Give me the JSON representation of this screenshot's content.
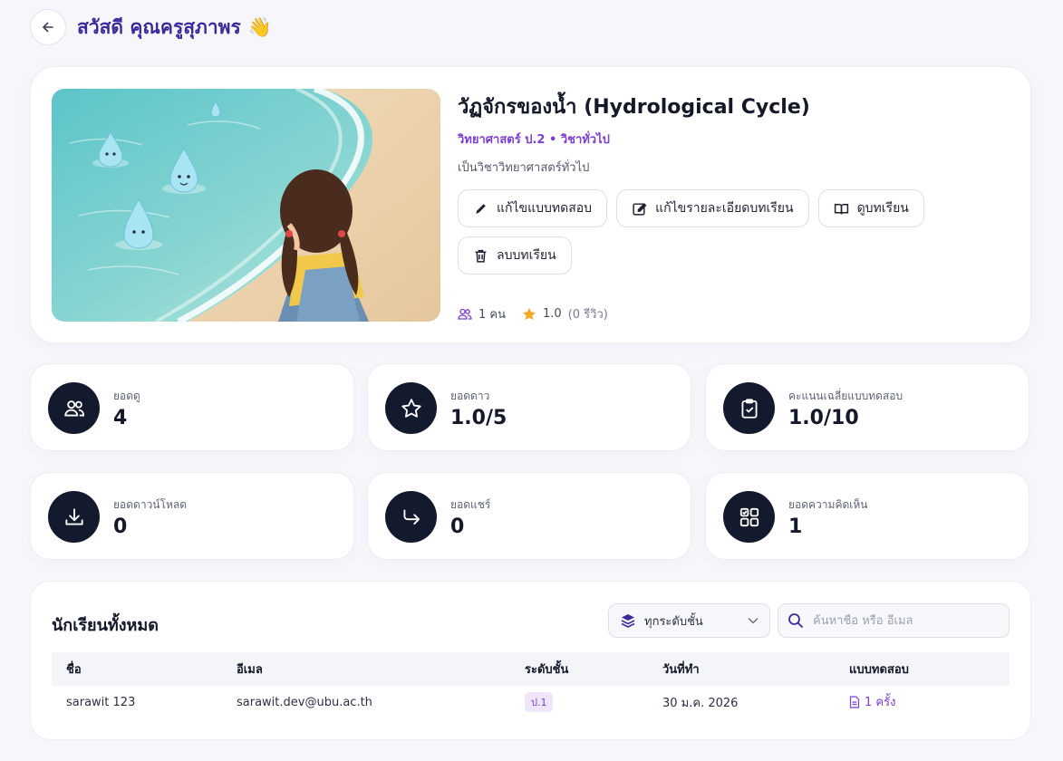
{
  "header": {
    "title": "สวัสดี คุณครูสุภาพร",
    "wave_emoji": "👋"
  },
  "lesson": {
    "title": "วัฏจักรของน้ำ (Hydrological Cycle)",
    "meta": "วิทยาศาสตร์ ป.2 • วิชาทั่วไป",
    "description": "เป็นวิชาวิทยาศาสตร์ทั่วไป",
    "actions": {
      "edit_quiz": "แก้ไขแบบทดสอบ",
      "edit_details": "แก้ไขรายละเอียดบทเรียน",
      "view_lesson": "ดูบทเรียน",
      "delete_lesson": "ลบบทเรียน"
    },
    "learners": "1 คน",
    "rating": "1.0",
    "reviews": "(0 รีวิว)"
  },
  "stats": [
    {
      "label": "ยอดดู",
      "value": "4",
      "icon": "users-icon"
    },
    {
      "label": "ยอดดาว",
      "value": "1.0/5",
      "icon": "star-icon"
    },
    {
      "label": "คะแนนเฉลี่ยแบบทดสอบ",
      "value": "1.0/10",
      "icon": "clipboard-check-icon"
    },
    {
      "label": "ยอดดาวน์โหลด",
      "value": "0",
      "icon": "download-icon"
    },
    {
      "label": "ยอดแชร์",
      "value": "0",
      "icon": "share-arrow-icon"
    },
    {
      "label": "ยอดความคิดเห็น",
      "value": "1",
      "icon": "grid-check-icon"
    }
  ],
  "students": {
    "title": "นักเรียนทั้งหมด",
    "level_filter": "ทุกระดับชั้น",
    "search_placeholder": "ค้นหาชื่อ หรือ อีเมล",
    "columns": [
      "ชื่อ",
      "อีเมล",
      "ระดับชั้น",
      "วันที่ทำ",
      "แบบทดสอบ"
    ],
    "rows": [
      {
        "name": "sarawit 123",
        "email": "sarawit.dev@ubu.ac.th",
        "grade": "ป.1",
        "date": "30 ม.ค. 2026",
        "quiz": "1 ครั้ง"
      }
    ]
  },
  "colors": {
    "accent": "#7b3fd1",
    "title": "#3b2a9c",
    "icon_bg": "#141a2e",
    "star": "#f5a623"
  }
}
